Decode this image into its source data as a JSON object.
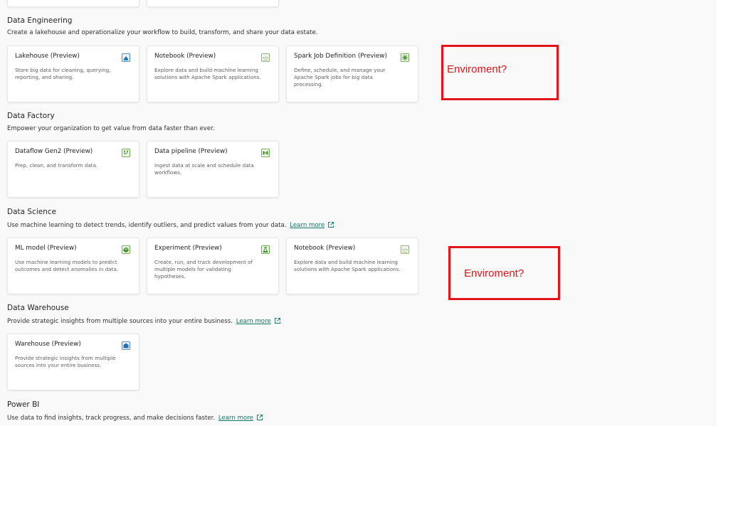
{
  "sections": {
    "data_engineering": {
      "title": "Data Engineering",
      "description": "Create a lakehouse and operationalize your workflow to build, transform, and share your data estate.",
      "cards": [
        {
          "title": "Lakehouse (Preview)",
          "desc": "Store big data for cleaning, querying, reporting, and sharing.",
          "icon": "lakehouse-icon"
        },
        {
          "title": "Notebook (Preview)",
          "desc": "Explore data and build machine learning solutions with Apache Spark applications.",
          "icon": "notebook-icon"
        },
        {
          "title": "Spark Job Definition (Preview)",
          "desc": "Define, schedule, and manage your Apache Spark jobs for big data processing.",
          "icon": "spark-job-icon"
        }
      ]
    },
    "data_factory": {
      "title": "Data Factory",
      "description": "Empower your organization to get value from data faster than ever.",
      "cards": [
        {
          "title": "Dataflow Gen2 (Preview)",
          "desc": "Prep, clean, and transform data.",
          "icon": "dataflow-icon"
        },
        {
          "title": "Data pipeline (Preview)",
          "desc": "Ingest data at scale and schedule data workflows.",
          "icon": "pipeline-icon"
        }
      ]
    },
    "data_science": {
      "title": "Data Science",
      "description": "Use machine learning to detect trends, identify outliers, and predict values from your data.",
      "learn_more": "Learn more",
      "cards": [
        {
          "title": "ML model (Preview)",
          "desc": "Use machine learning models to predict outcomes and detect anomalies in data.",
          "icon": "ml-model-icon"
        },
        {
          "title": "Experiment (Preview)",
          "desc": "Create, run, and track development of multiple models for validating hypotheses.",
          "icon": "experiment-icon"
        },
        {
          "title": "Notebook (Preview)",
          "desc": "Explore data and build machine learning solutions with Apache Spark applications.",
          "icon": "notebook-icon"
        }
      ]
    },
    "data_warehouse": {
      "title": "Data Warehouse",
      "description": "Provide strategic insights from multiple sources into your entire business.",
      "learn_more": "Learn more",
      "cards": [
        {
          "title": "Warehouse (Preview)",
          "desc": "Provide strategic insights from multiple sources into your entire business.",
          "icon": "warehouse-icon"
        }
      ]
    },
    "power_bi": {
      "title": "Power BI",
      "description": "Use data to find insights, track progress, and make decisions faster.",
      "learn_more": "Learn more"
    }
  },
  "annotations": [
    {
      "text": "Enviroment?"
    },
    {
      "text": "Enviroment?"
    }
  ],
  "colors": {
    "accent_link": "#117865",
    "annotation_red": "#e3151a",
    "canvas_bg": "#f9f9f9"
  }
}
